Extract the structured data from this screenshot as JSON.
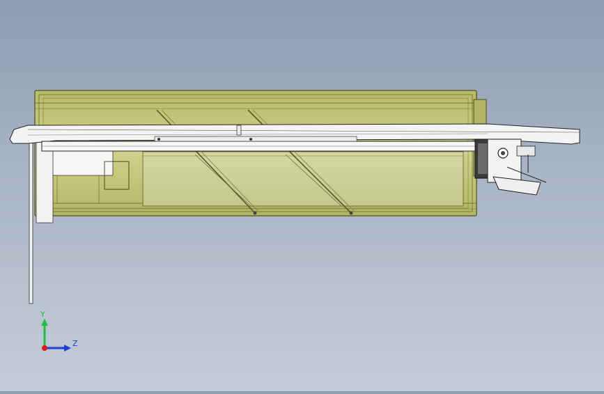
{
  "viewport": {
    "background_top": "#8f9cb0",
    "background_bottom": "#c4cdd9"
  },
  "model": {
    "housing_fill": "#c5c77a",
    "housing_stroke": "#5c5d22",
    "rail_fill": "#f4f4f4",
    "line_color": "#2a2a2a"
  },
  "triad": {
    "y_label": "Y",
    "z_label": "Z",
    "y_color": "#22c03a",
    "z_color": "#1c3fd8",
    "x_color": "#d81c1c"
  }
}
